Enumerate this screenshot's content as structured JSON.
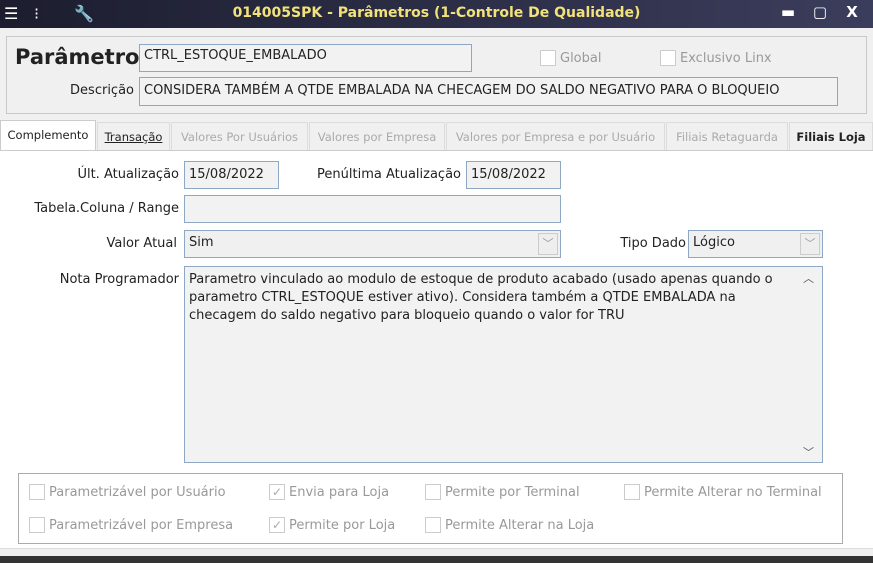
{
  "window": {
    "title": "014005SPK - Parâmetros (1-Controle De Qualidade)",
    "icons": [
      "list-icon",
      "traffic-light-icon",
      "wrench-icon"
    ],
    "minimize": "▬",
    "maximize": "▢",
    "close": "X"
  },
  "header": {
    "parametro_label": "Parâmetro",
    "parametro_value": "CTRL_ESTOQUE_EMBALADO",
    "descricao_label": "Descrição",
    "descricao_value": "CONSIDERA TAMBÉM A QTDE EMBALADA NA CHECAGEM DO SALDO NEGATIVO PARA O BLOQUEIO",
    "global_label": "Global",
    "global_checked": false,
    "exclusivo_label": "Exclusivo Linx",
    "exclusivo_checked": false
  },
  "tabs": [
    {
      "label": "Complemento",
      "state": "active"
    },
    {
      "label": "Transação",
      "state": "enabled"
    },
    {
      "label": "Valores Por Usuários",
      "state": "disabled"
    },
    {
      "label": "Valores por Empresa",
      "state": "disabled"
    },
    {
      "label": "Valores por Empresa e por Usuário",
      "state": "disabled"
    },
    {
      "label": "Filiais Retaguarda",
      "state": "disabled"
    },
    {
      "label": "Filiais Loja",
      "state": "enabled"
    }
  ],
  "form": {
    "ult_label": "Últ. Atualização",
    "ult_value": "15/08/2022",
    "penult_label": "Penúltima Atualização",
    "penult_value": "15/08/2022",
    "tabela_label": "Tabela.Coluna / Range",
    "tabela_value": "",
    "valor_label": "Valor Atual",
    "valor_value": "Sim",
    "tipo_label": "Tipo Dado",
    "tipo_value": "Lógico",
    "nota_label": "Nota Programador",
    "nota_value": "Parametro vinculado ao modulo de estoque de produto acabado (usado apenas quando o parametro CTRL_ESTOQUE estiver ativo). Considera também a QTDE EMBALADA na checagem do saldo negativo para bloqueio quando o valor for TRU"
  },
  "checkboxes": [
    {
      "label": "Parametrizável por Usuário",
      "checked": false
    },
    {
      "label": "Envia para Loja",
      "checked": true
    },
    {
      "label": "Permite por Terminal",
      "checked": false
    },
    {
      "label": "Permite Alterar no Terminal",
      "checked": false
    },
    {
      "label": "Parametrizável por Empresa",
      "checked": false
    },
    {
      "label": "Permite por Loja",
      "checked": true
    },
    {
      "label": "Permite Alterar na Loja",
      "checked": false
    }
  ]
}
